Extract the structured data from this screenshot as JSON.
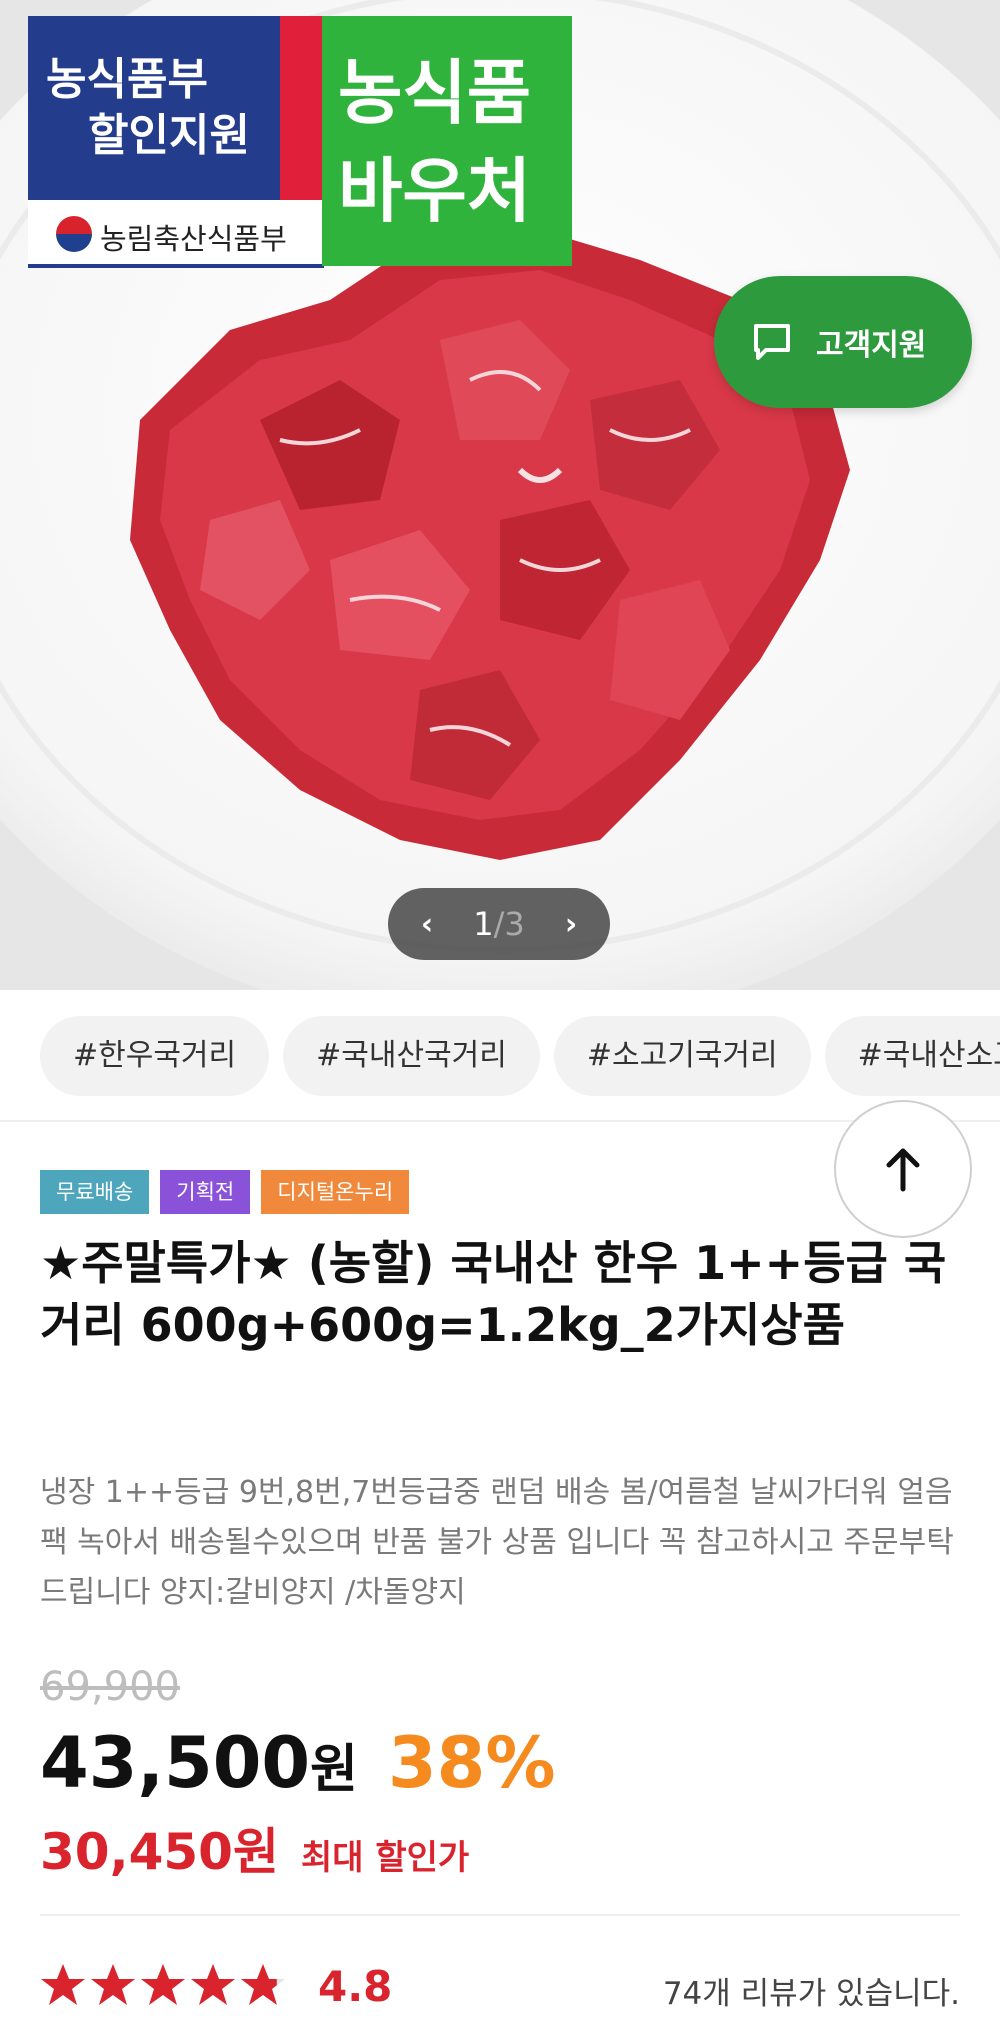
{
  "hero": {
    "gov_badge": {
      "line1": "농식품부",
      "line2": "할인지원",
      "ministry": "농림축산식품부"
    },
    "voucher_badge": {
      "line1": "농식품",
      "line2": "바우처"
    },
    "support_button": "고객지원",
    "pager": {
      "current": "1",
      "separator": "/",
      "total": "3"
    }
  },
  "tags": [
    "#한우국거리",
    "#국내산국거리",
    "#소고기국거리",
    "#국내산소고기"
  ],
  "labels": [
    "무료배송",
    "기획전",
    "디지털온누리"
  ],
  "product": {
    "title": "★주말특가★ (농할) 국내산 한우 1++등급 국거리 600g+600g=1.2kg_2가지상품",
    "description": "냉장 1++등급 9번,8번,7번등급중 랜덤 배송 봄/여름철 날씨가더워 얼음팩 녹아서 배송될수있으며 반품 불가 상품 입니다 꼭 참고하시고 주문부탁드립니다 양지:갈비양지 /차돌양지"
  },
  "price": {
    "original": "69,900",
    "current": "43,500",
    "unit": "원",
    "discount_rate": "38%",
    "max_discount_price": "30,450원",
    "max_discount_label": "최대 할인가"
  },
  "rating": {
    "score": "4.8",
    "stars": 4.8,
    "review_text": "74개 리뷰가 있습니다."
  },
  "colors": {
    "accent_red": "#d9232d",
    "discount_orange": "#f58a1f",
    "support_green": "#2e9a3e"
  }
}
